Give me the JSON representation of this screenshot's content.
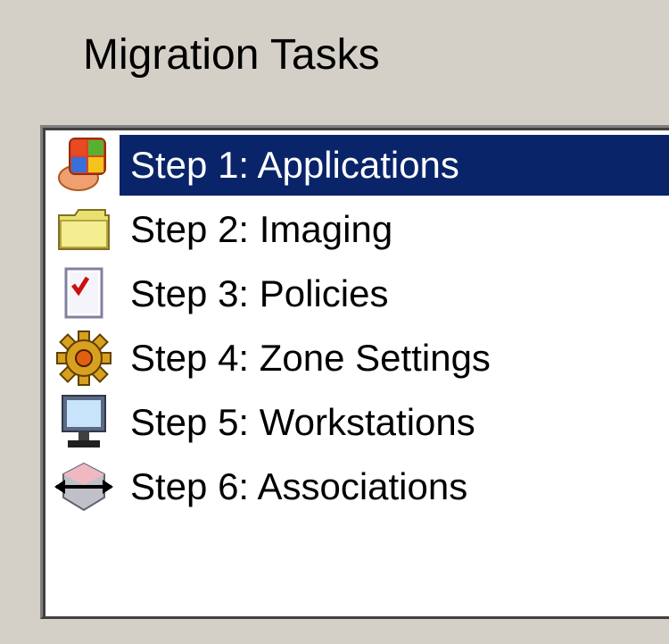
{
  "panel": {
    "title": "Migration Tasks"
  },
  "tasks": [
    {
      "label": "Step 1: Applications",
      "icon": "applications-icon",
      "selected": true
    },
    {
      "label": "Step 2: Imaging",
      "icon": "folder-icon",
      "selected": false
    },
    {
      "label": "Step 3: Policies",
      "icon": "policy-checklist-icon",
      "selected": false
    },
    {
      "label": "Step 4: Zone Settings",
      "icon": "gear-settings-icon",
      "selected": false
    },
    {
      "label": "Step 5: Workstations",
      "icon": "monitor-icon",
      "selected": false
    },
    {
      "label": "Step 6: Associations",
      "icon": "association-arrows-icon",
      "selected": false
    }
  ],
  "colors": {
    "background": "#d4d0c8",
    "selection": "#0a246a",
    "list_background": "#ffffff"
  }
}
